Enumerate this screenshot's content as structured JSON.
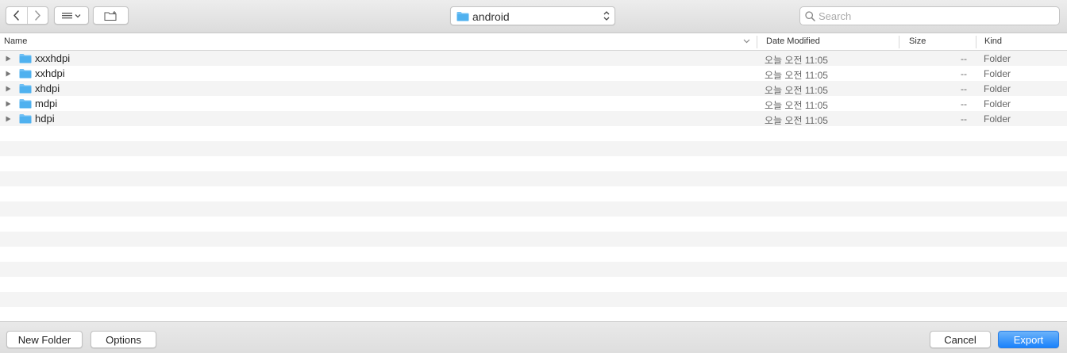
{
  "toolbar": {
    "location_label": "android",
    "search_placeholder": "Search"
  },
  "columns": {
    "name": "Name",
    "date_modified": "Date Modified",
    "size": "Size",
    "kind": "Kind"
  },
  "rows": [
    {
      "name": "xxxhdpi",
      "date": "오늘 오전 11:05",
      "size": "--",
      "kind": "Folder"
    },
    {
      "name": "xxhdpi",
      "date": "오늘 오전 11:05",
      "size": "--",
      "kind": "Folder"
    },
    {
      "name": "xhdpi",
      "date": "오늘 오전 11:05",
      "size": "--",
      "kind": "Folder"
    },
    {
      "name": "mdpi",
      "date": "오늘 오전 11:05",
      "size": "--",
      "kind": "Folder"
    },
    {
      "name": "hdpi",
      "date": "오늘 오전 11:05",
      "size": "--",
      "kind": "Folder"
    }
  ],
  "footer": {
    "new_folder_label": "New Folder",
    "options_label": "Options",
    "cancel_label": "Cancel",
    "export_label": "Export"
  },
  "colors": {
    "accent": "#1a82fb",
    "folder": "#5ab8f2"
  },
  "icons": {
    "back": "chevron-left-icon",
    "forward": "chevron-right-icon",
    "view": "list-view-icon",
    "new_folder": "new-folder-icon",
    "location": "folder-icon",
    "search": "magnifier-icon",
    "disclosure": "disclosure-triangle-icon"
  }
}
